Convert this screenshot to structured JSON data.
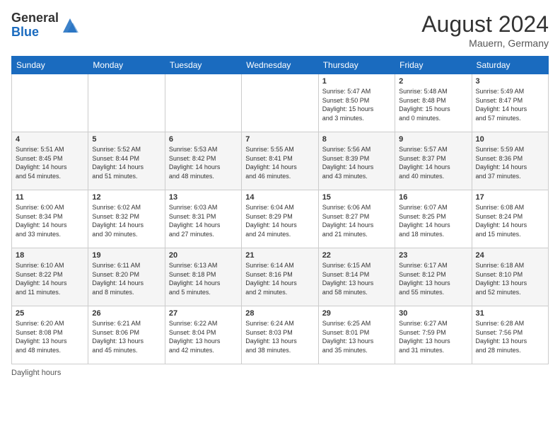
{
  "header": {
    "logo_general": "General",
    "logo_blue": "Blue",
    "month_year": "August 2024",
    "location": "Mauern, Germany"
  },
  "footer": {
    "label": "Daylight hours"
  },
  "weekdays": [
    "Sunday",
    "Monday",
    "Tuesday",
    "Wednesday",
    "Thursday",
    "Friday",
    "Saturday"
  ],
  "weeks": [
    [
      {
        "day": "",
        "info": ""
      },
      {
        "day": "",
        "info": ""
      },
      {
        "day": "",
        "info": ""
      },
      {
        "day": "",
        "info": ""
      },
      {
        "day": "1",
        "info": "Sunrise: 5:47 AM\nSunset: 8:50 PM\nDaylight: 15 hours\nand 3 minutes."
      },
      {
        "day": "2",
        "info": "Sunrise: 5:48 AM\nSunset: 8:48 PM\nDaylight: 15 hours\nand 0 minutes."
      },
      {
        "day": "3",
        "info": "Sunrise: 5:49 AM\nSunset: 8:47 PM\nDaylight: 14 hours\nand 57 minutes."
      }
    ],
    [
      {
        "day": "4",
        "info": "Sunrise: 5:51 AM\nSunset: 8:45 PM\nDaylight: 14 hours\nand 54 minutes."
      },
      {
        "day": "5",
        "info": "Sunrise: 5:52 AM\nSunset: 8:44 PM\nDaylight: 14 hours\nand 51 minutes."
      },
      {
        "day": "6",
        "info": "Sunrise: 5:53 AM\nSunset: 8:42 PM\nDaylight: 14 hours\nand 48 minutes."
      },
      {
        "day": "7",
        "info": "Sunrise: 5:55 AM\nSunset: 8:41 PM\nDaylight: 14 hours\nand 46 minutes."
      },
      {
        "day": "8",
        "info": "Sunrise: 5:56 AM\nSunset: 8:39 PM\nDaylight: 14 hours\nand 43 minutes."
      },
      {
        "day": "9",
        "info": "Sunrise: 5:57 AM\nSunset: 8:37 PM\nDaylight: 14 hours\nand 40 minutes."
      },
      {
        "day": "10",
        "info": "Sunrise: 5:59 AM\nSunset: 8:36 PM\nDaylight: 14 hours\nand 37 minutes."
      }
    ],
    [
      {
        "day": "11",
        "info": "Sunrise: 6:00 AM\nSunset: 8:34 PM\nDaylight: 14 hours\nand 33 minutes."
      },
      {
        "day": "12",
        "info": "Sunrise: 6:02 AM\nSunset: 8:32 PM\nDaylight: 14 hours\nand 30 minutes."
      },
      {
        "day": "13",
        "info": "Sunrise: 6:03 AM\nSunset: 8:31 PM\nDaylight: 14 hours\nand 27 minutes."
      },
      {
        "day": "14",
        "info": "Sunrise: 6:04 AM\nSunset: 8:29 PM\nDaylight: 14 hours\nand 24 minutes."
      },
      {
        "day": "15",
        "info": "Sunrise: 6:06 AM\nSunset: 8:27 PM\nDaylight: 14 hours\nand 21 minutes."
      },
      {
        "day": "16",
        "info": "Sunrise: 6:07 AM\nSunset: 8:25 PM\nDaylight: 14 hours\nand 18 minutes."
      },
      {
        "day": "17",
        "info": "Sunrise: 6:08 AM\nSunset: 8:24 PM\nDaylight: 14 hours\nand 15 minutes."
      }
    ],
    [
      {
        "day": "18",
        "info": "Sunrise: 6:10 AM\nSunset: 8:22 PM\nDaylight: 14 hours\nand 11 minutes."
      },
      {
        "day": "19",
        "info": "Sunrise: 6:11 AM\nSunset: 8:20 PM\nDaylight: 14 hours\nand 8 minutes."
      },
      {
        "day": "20",
        "info": "Sunrise: 6:13 AM\nSunset: 8:18 PM\nDaylight: 14 hours\nand 5 minutes."
      },
      {
        "day": "21",
        "info": "Sunrise: 6:14 AM\nSunset: 8:16 PM\nDaylight: 14 hours\nand 2 minutes."
      },
      {
        "day": "22",
        "info": "Sunrise: 6:15 AM\nSunset: 8:14 PM\nDaylight: 13 hours\nand 58 minutes."
      },
      {
        "day": "23",
        "info": "Sunrise: 6:17 AM\nSunset: 8:12 PM\nDaylight: 13 hours\nand 55 minutes."
      },
      {
        "day": "24",
        "info": "Sunrise: 6:18 AM\nSunset: 8:10 PM\nDaylight: 13 hours\nand 52 minutes."
      }
    ],
    [
      {
        "day": "25",
        "info": "Sunrise: 6:20 AM\nSunset: 8:08 PM\nDaylight: 13 hours\nand 48 minutes."
      },
      {
        "day": "26",
        "info": "Sunrise: 6:21 AM\nSunset: 8:06 PM\nDaylight: 13 hours\nand 45 minutes."
      },
      {
        "day": "27",
        "info": "Sunrise: 6:22 AM\nSunset: 8:04 PM\nDaylight: 13 hours\nand 42 minutes."
      },
      {
        "day": "28",
        "info": "Sunrise: 6:24 AM\nSunset: 8:03 PM\nDaylight: 13 hours\nand 38 minutes."
      },
      {
        "day": "29",
        "info": "Sunrise: 6:25 AM\nSunset: 8:01 PM\nDaylight: 13 hours\nand 35 minutes."
      },
      {
        "day": "30",
        "info": "Sunrise: 6:27 AM\nSunset: 7:59 PM\nDaylight: 13 hours\nand 31 minutes."
      },
      {
        "day": "31",
        "info": "Sunrise: 6:28 AM\nSunset: 7:56 PM\nDaylight: 13 hours\nand 28 minutes."
      }
    ]
  ]
}
